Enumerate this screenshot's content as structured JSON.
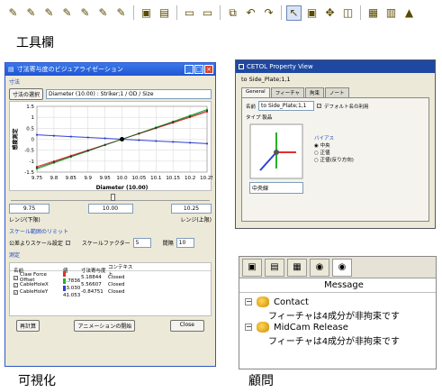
{
  "toolbar": {
    "buttons": [
      {
        "icon": "feature-pencil-1-icon",
        "glyph": "✎"
      },
      {
        "icon": "feature-pencil-2-icon",
        "glyph": "✎"
      },
      {
        "icon": "feature-pencil-3-icon",
        "glyph": "✎"
      },
      {
        "icon": "feature-pencil-4-icon",
        "glyph": "✎"
      },
      {
        "icon": "feature-pencil-5-icon",
        "glyph": "✎"
      },
      {
        "icon": "feature-pencil-6-icon",
        "glyph": "✎"
      },
      {
        "icon": "feature-pencil-7-icon",
        "glyph": "✎"
      },
      {
        "icon": "image-frame-icon",
        "glyph": "▣"
      },
      {
        "icon": "datum-frame-icon",
        "glyph": "▤"
      },
      {
        "icon": "window-icon",
        "glyph": "▭"
      },
      {
        "icon": "window-split-icon",
        "glyph": "▭"
      },
      {
        "icon": "edit-feature-icon",
        "glyph": "⧉"
      },
      {
        "icon": "undo-icon",
        "glyph": "↶"
      },
      {
        "icon": "redo-icon",
        "glyph": "↷"
      },
      {
        "icon": "pointer-tool-icon",
        "glyph": "↖"
      },
      {
        "icon": "monitor-icon",
        "glyph": "▣"
      },
      {
        "icon": "move-view-icon",
        "glyph": "✥"
      },
      {
        "icon": "layers-icon",
        "glyph": "◫"
      },
      {
        "icon": "calculator-icon",
        "glyph": "▦"
      },
      {
        "icon": "grid-icon",
        "glyph": "▥"
      },
      {
        "icon": "picture-icon",
        "glyph": "▲"
      }
    ]
  },
  "captions": {
    "toolbar": "工具欄",
    "visualization": "可視化",
    "advisor": "顧問"
  },
  "viz": {
    "title": "寸法寄与度のビジュアライゼーション",
    "group_dimension": "寸法",
    "select_button": "寸法の選択",
    "dimension_value": "Diameter (10.00) : Striker;1 / OD / Size",
    "slider_left": "9.75",
    "slider_mid": "10.00",
    "slider_right": "10.25",
    "range_low_label": "レンジ(下限)",
    "range_high_label": "レンジ(上限)",
    "group_scale": "スケール範囲のリミット",
    "tolerance_scale_label": "公差よりスケール設定",
    "scale_factor_label": "スケールファクター",
    "scale_factor_value": "5",
    "interval_label": "間隔",
    "interval_value": "10",
    "group_measure": "測定",
    "columns": [
      "名前",
      "値",
      "寸法寄与度",
      "コンテキスト"
    ],
    "rows": [
      {
        "name": "Claw Force Offset",
        "value": "9.7836",
        "contribution": "5.18844",
        "context": "Closed",
        "color": "#e03030"
      },
      {
        "name": "CableHoleX",
        "value": "63.030",
        "contribution": "5.56607",
        "context": "Closed",
        "color": "#28b028"
      },
      {
        "name": "CableHoleY",
        "value": "41.053",
        "contribution": "-0.84751",
        "context": "Closed",
        "color": "#3040d0"
      }
    ],
    "recalc_button": "再計算",
    "animate_button": "アニメーションの開始",
    "close_button": "Close"
  },
  "chart_data": {
    "type": "line",
    "title": "",
    "xlabel": "Diameter (10.00)",
    "ylabel": "感度測定",
    "x": [
      9.75,
      9.8,
      9.85,
      9.9,
      9.95,
      10,
      10.05,
      10.1,
      10.15,
      10.2,
      10.25
    ],
    "xlim": [
      9.75,
      10.25
    ],
    "ylim": [
      -1.5,
      1.5
    ],
    "yticks": [
      -1.5,
      -1,
      -0.5,
      0,
      0.5,
      1,
      1.5
    ],
    "grid": true,
    "series": [
      {
        "color": "#e03030",
        "values": [
          -1.25,
          -1.0,
          -0.75,
          -0.5,
          -0.25,
          0,
          0.25,
          0.5,
          0.75,
          1.0,
          1.25
        ]
      },
      {
        "color": "#28b028",
        "values": [
          -1.35,
          -1.08,
          -0.81,
          -0.54,
          -0.27,
          0,
          0.27,
          0.54,
          0.81,
          1.08,
          1.35
        ]
      },
      {
        "color": "#3040d0",
        "values": [
          0.2,
          0.16,
          0.12,
          0.08,
          0.04,
          0,
          -0.04,
          -0.08,
          -0.12,
          -0.16,
          -0.2
        ]
      },
      {
        "color": "#333333",
        "values": [
          -1.3,
          -1.04,
          -0.78,
          -0.52,
          -0.26,
          0,
          0.26,
          0.52,
          0.78,
          1.04,
          1.3
        ]
      }
    ]
  },
  "prop": {
    "title": "CETOL Property View",
    "object_title": "to Side_Plate;1,1",
    "tabs": [
      "General",
      "フィーチャ",
      "拘束",
      "ノート"
    ],
    "name_label": "名前",
    "name_value": "to Side_Plate;1,1",
    "default_label": "デフォルト名の利用",
    "type_label": "タイプ",
    "type_value": "製品",
    "bias_label": "バイアス",
    "bias_options": [
      "中央",
      "正値",
      "正値(反り方向)"
    ],
    "combo_value": "中央線"
  },
  "advisor": {
    "header": "Message",
    "tab_icons": [
      "cube-icon",
      "document-icon",
      "feature-icon",
      "constraint-check-icon",
      "constraint-check-icon"
    ],
    "items": [
      {
        "name": "Contact",
        "message": "フィーチャは4成分が非拘束です"
      },
      {
        "name": "MidCam Release",
        "message": "フィーチャは4成分が非拘束です"
      }
    ]
  }
}
